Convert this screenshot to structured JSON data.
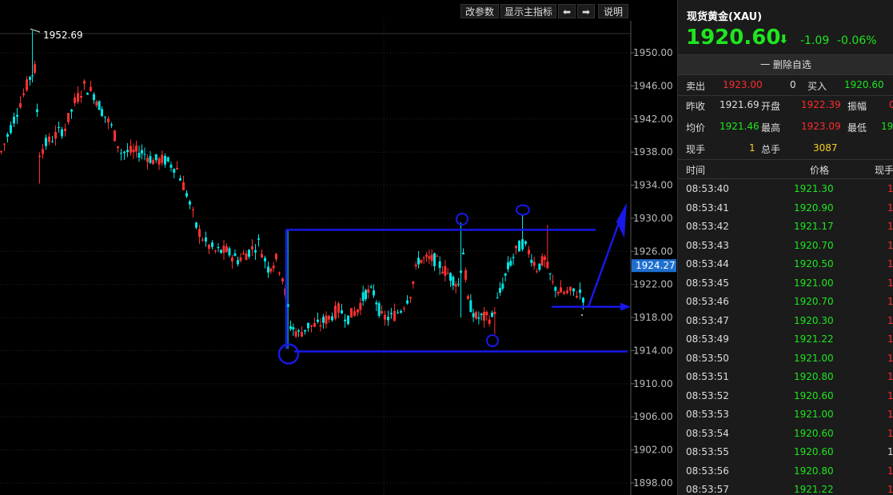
{
  "toolbar": {
    "params_label": "改参数",
    "main_indicator_label": "显示主指标",
    "left_arrow": "⬅",
    "right_arrow": "➡",
    "help_label": "说明"
  },
  "chart": {
    "high_label": "1952.69",
    "current_price_label": "1924.27",
    "y_ticks": [
      "1950.00",
      "1946.00",
      "1942.00",
      "1938.00",
      "1934.00",
      "1930.00",
      "1926.00",
      "1922.00",
      "1918.00",
      "1914.00",
      "1910.00",
      "1906.00",
      "1902.00",
      "1898.00"
    ],
    "colors": {
      "up": "#ff3030",
      "down": "#00e5e5",
      "annotation": "#1818e8",
      "grid": "#2a2a2a",
      "price_tag": "#1f6fd0"
    }
  },
  "quote": {
    "title": "现货黄金(XAU)",
    "price": "1920.60",
    "change": "-1.09",
    "change_pct": "-0.06%",
    "delete_watch": "一 删除自选",
    "sell_label": "卖出",
    "sell_price": "1923.00",
    "sell_qty": "0",
    "buy_label": "买入",
    "buy_price": "1920.60",
    "prev_close_label": "昨收",
    "prev_close": "1921.69",
    "open_label": "开盘",
    "open": "1922.39",
    "amplitude_label": "振幅",
    "amplitude": "0",
    "avg_label": "均价",
    "avg": "1921.46",
    "high_label": "最高",
    "high": "1923.09",
    "low_label": "最低",
    "low": "19",
    "cur_vol_label": "现手",
    "cur_vol": "1",
    "total_vol_label": "总手",
    "total_vol": "3087"
  },
  "ticks": {
    "headers": {
      "time": "时间",
      "price": "价格",
      "vol": "现手"
    },
    "rows": [
      {
        "time": "08:53:40",
        "price": "1921.30",
        "vol": "1"
      },
      {
        "time": "08:53:41",
        "price": "1920.90",
        "vol": "1"
      },
      {
        "time": "08:53:42",
        "price": "1921.17",
        "vol": "1"
      },
      {
        "time": "08:53:43",
        "price": "1920.70",
        "vol": "1"
      },
      {
        "time": "08:53:44",
        "price": "1920.50",
        "vol": "1"
      },
      {
        "time": "08:53:45",
        "price": "1921.00",
        "vol": "1"
      },
      {
        "time": "08:53:46",
        "price": "1920.70",
        "vol": "1"
      },
      {
        "time": "08:53:47",
        "price": "1920.30",
        "vol": "1"
      },
      {
        "time": "08:53:49",
        "price": "1921.22",
        "vol": "1"
      },
      {
        "time": "08:53:50",
        "price": "1921.00",
        "vol": "1"
      },
      {
        "time": "08:53:51",
        "price": "1920.80",
        "vol": "1"
      },
      {
        "time": "08:53:52",
        "price": "1920.60",
        "vol": "1"
      },
      {
        "time": "08:53:53",
        "price": "1921.00",
        "vol": "1"
      },
      {
        "time": "08:53:54",
        "price": "1920.60",
        "vol": "1"
      },
      {
        "time": "08:53:55",
        "price": "1920.60",
        "vol": "1"
      },
      {
        "time": "08:53:56",
        "price": "1920.80",
        "vol": "1"
      },
      {
        "time": "08:53:57",
        "price": "1921.22",
        "vol": "1"
      }
    ]
  }
}
